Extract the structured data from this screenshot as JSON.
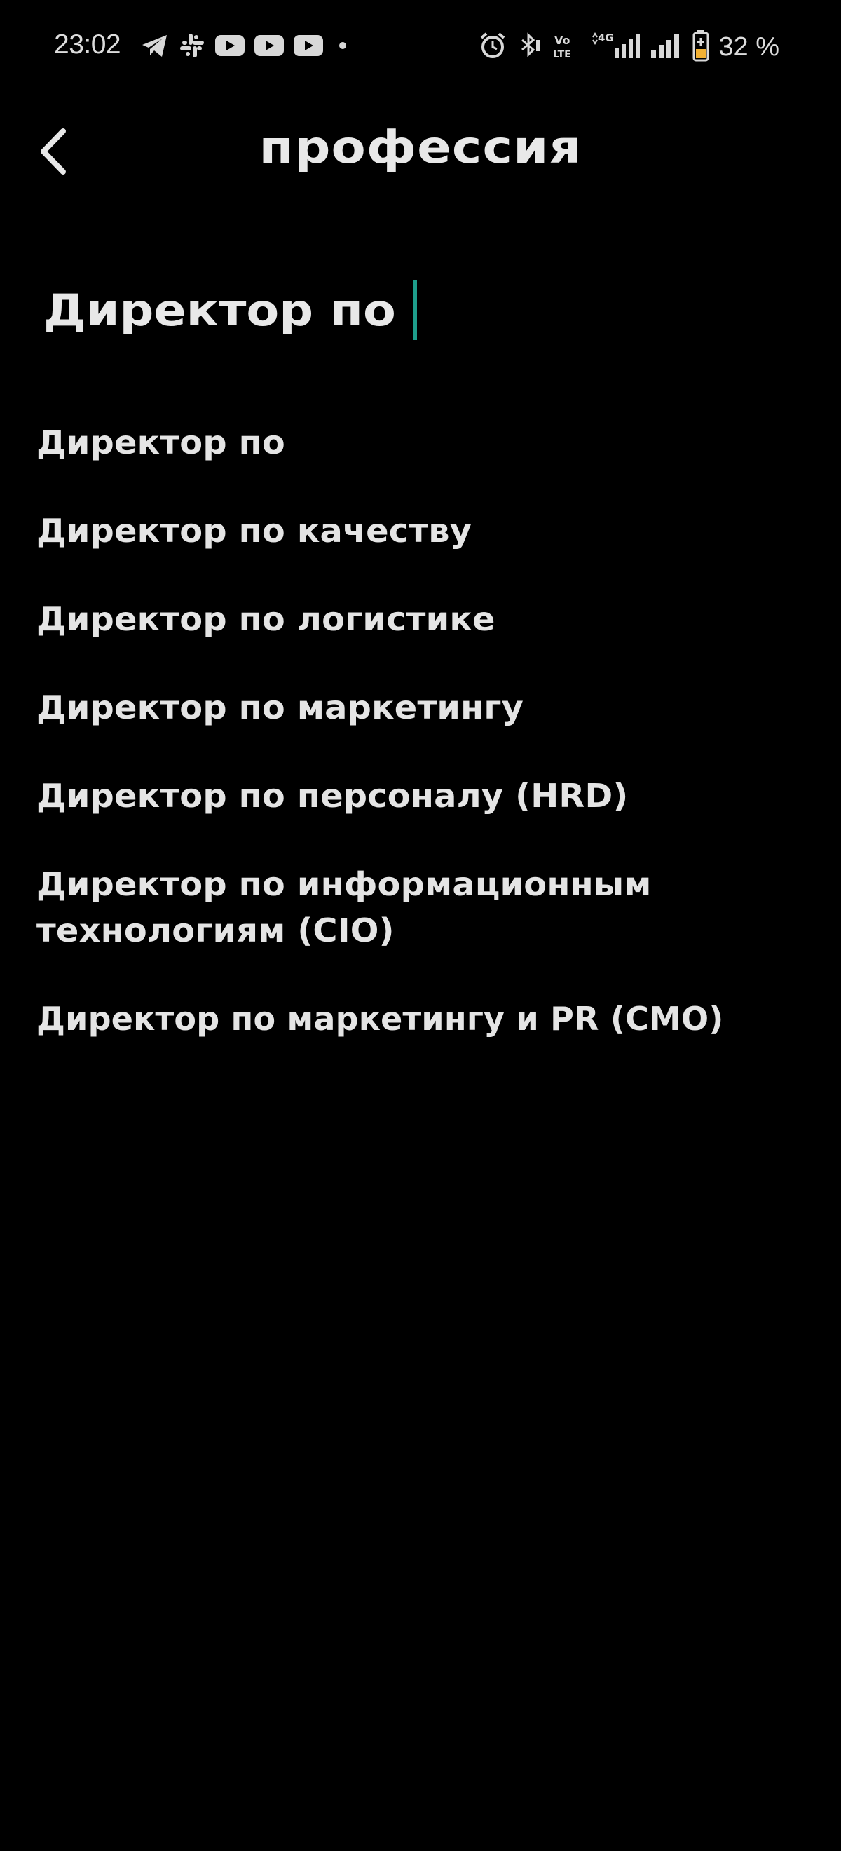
{
  "status_bar": {
    "time": "23:02",
    "battery_percent": "32 %",
    "left_icons": [
      "telegram-icon",
      "slack-icon",
      "youtube-icon",
      "youtube-icon",
      "youtube-icon",
      "dot-icon"
    ],
    "right_icons": [
      "alarm-icon",
      "bluetooth-icon",
      "volte-icon",
      "4g-signal-icon",
      "signal-icon",
      "battery-icon"
    ]
  },
  "header": {
    "title": "профессия",
    "back_icon": "chevron-left-icon"
  },
  "search": {
    "value": "Директор по ",
    "caret_color": "#1e9e8c"
  },
  "suggestions": [
    "Директор по",
    "Директор по качеству",
    "Директор по логистике",
    "Директор по маркетингу",
    "Директор по персоналу (HRD)",
    "Директор по информационным технологиям (CIO)",
    "Директор по маркетингу и PR (CMO)"
  ],
  "colors": {
    "background": "#000000",
    "text": "#e4e4e4",
    "accent": "#1e9e8c"
  }
}
